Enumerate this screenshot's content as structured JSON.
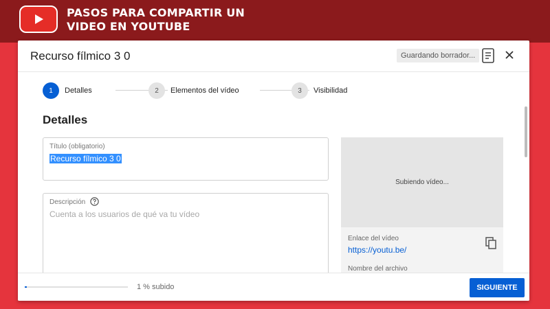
{
  "banner": {
    "title": "PASOS PARA COMPARTIR UN VIDEO EN YOUTUBE",
    "logo_icon": "youtube-play-icon"
  },
  "dialog": {
    "title": "Recurso fílmico 3 0",
    "saving_status": "Guardando borrador...",
    "feedback_icon": "feedback-icon",
    "close_icon": "close-icon"
  },
  "steps": [
    {
      "number": "1",
      "label": "Detalles",
      "active": true
    },
    {
      "number": "2",
      "label": "Elementos del vídeo",
      "active": false
    },
    {
      "number": "3",
      "label": "Visibilidad",
      "active": false
    }
  ],
  "details": {
    "section_title": "Detalles",
    "title_field": {
      "label": "Título (obligatorio)",
      "value": "Recurso fílmico 3 0"
    },
    "description_field": {
      "label": "Descripción",
      "placeholder": "Cuenta a los usuarios de qué va tu vídeo"
    }
  },
  "preview": {
    "status": "Subiendo vídeo...",
    "link_label": "Enlace del vídeo",
    "link_value": "https://youtu.be/",
    "filename_label": "Nombre del archivo"
  },
  "footer": {
    "progress_percent": 1,
    "progress_text": "1 % subido",
    "next_label": "SIGUIENTE"
  },
  "colors": {
    "accent": "#065fd4",
    "banner_bg": "#8b1a1c",
    "page_bg": "#e5343d"
  }
}
